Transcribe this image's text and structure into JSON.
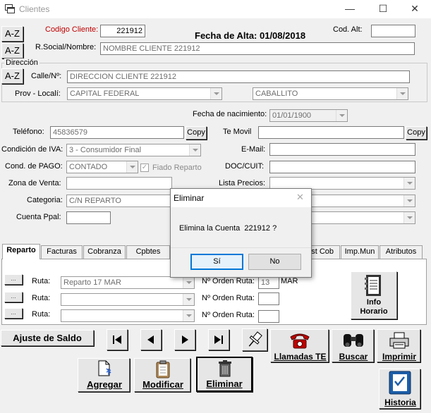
{
  "window": {
    "title": "Clientes",
    "minimize": "—",
    "maximize": "☐",
    "close": "✕"
  },
  "header": {
    "codigo_label": "Codigo Cliente:",
    "codigo_value": "221912",
    "fecha_alta": "Fecha de Alta: 01/08/2018",
    "cod_alt_label": "Cod. Alt:",
    "cod_alt_value": "",
    "az1": "A-Z",
    "az2": "A-Z",
    "razon_label": "R.Social/Nombre:",
    "razon_value": "NOMBRE CLIENTE 221912"
  },
  "direccion": {
    "group_label": "Dirección",
    "az": "A-Z",
    "calle_label": "Calle/Nº:",
    "calle_value": "DIRECCION CLIENTE 221912",
    "prov_label": "Prov - Localí:",
    "provincia": "CAPITAL FEDERAL",
    "localidad": "CABALLITO"
  },
  "fields": {
    "fecha_nac_label": "Fecha de nacimiento:",
    "fecha_nac_value": "01/01/1900",
    "telefono_label": "Teléfono:",
    "telefono_value": "45836579",
    "copy1": "Copy",
    "temovil_label": "Te Movil",
    "copy2": "Copy",
    "iva_label": "Condición de IVA:",
    "iva_value": "3 - Consumidor Final",
    "email_label": "E-Mail:",
    "pago_label": "Cond. de PAGO:",
    "pago_value": "CONTADO",
    "fiado_label": "Fiado Reparto",
    "doc_label": "DOC/CUIT:",
    "zona_label": "Zona de Venta:",
    "lista_label": "Lista Precios:",
    "categoria_label": "Categoria:",
    "categoria_value": "C/N REPARTO",
    "cuenta_label": "Cuenta Ppal:"
  },
  "tabs": [
    "Reparto",
    "Facturas",
    "Cobranza",
    "Cpbtes",
    "st Cob",
    "Imp.Mun",
    "Atributos"
  ],
  "reparto": {
    "dots": "...",
    "ruta_label": "Ruta:",
    "ruta1": "Reparto 17 MAR",
    "orden_label": "Nº Orden Ruta:",
    "orden1": "13",
    "orden1_suffix": "MAR",
    "info_horario": "Info Horario"
  },
  "actions": {
    "ajuste": "Ajuste de Saldo",
    "llamadas": "Llamadas TE",
    "buscar": "Buscar",
    "imprimir": "Imprimir",
    "agregar": "Agregar",
    "modificar": "Modificar",
    "eliminar": "Eliminar",
    "historia": "Historia"
  },
  "dialog": {
    "title": "Eliminar",
    "message": "Elimina la Cuenta  221912 ?",
    "yes": "Sí",
    "no": "No"
  }
}
